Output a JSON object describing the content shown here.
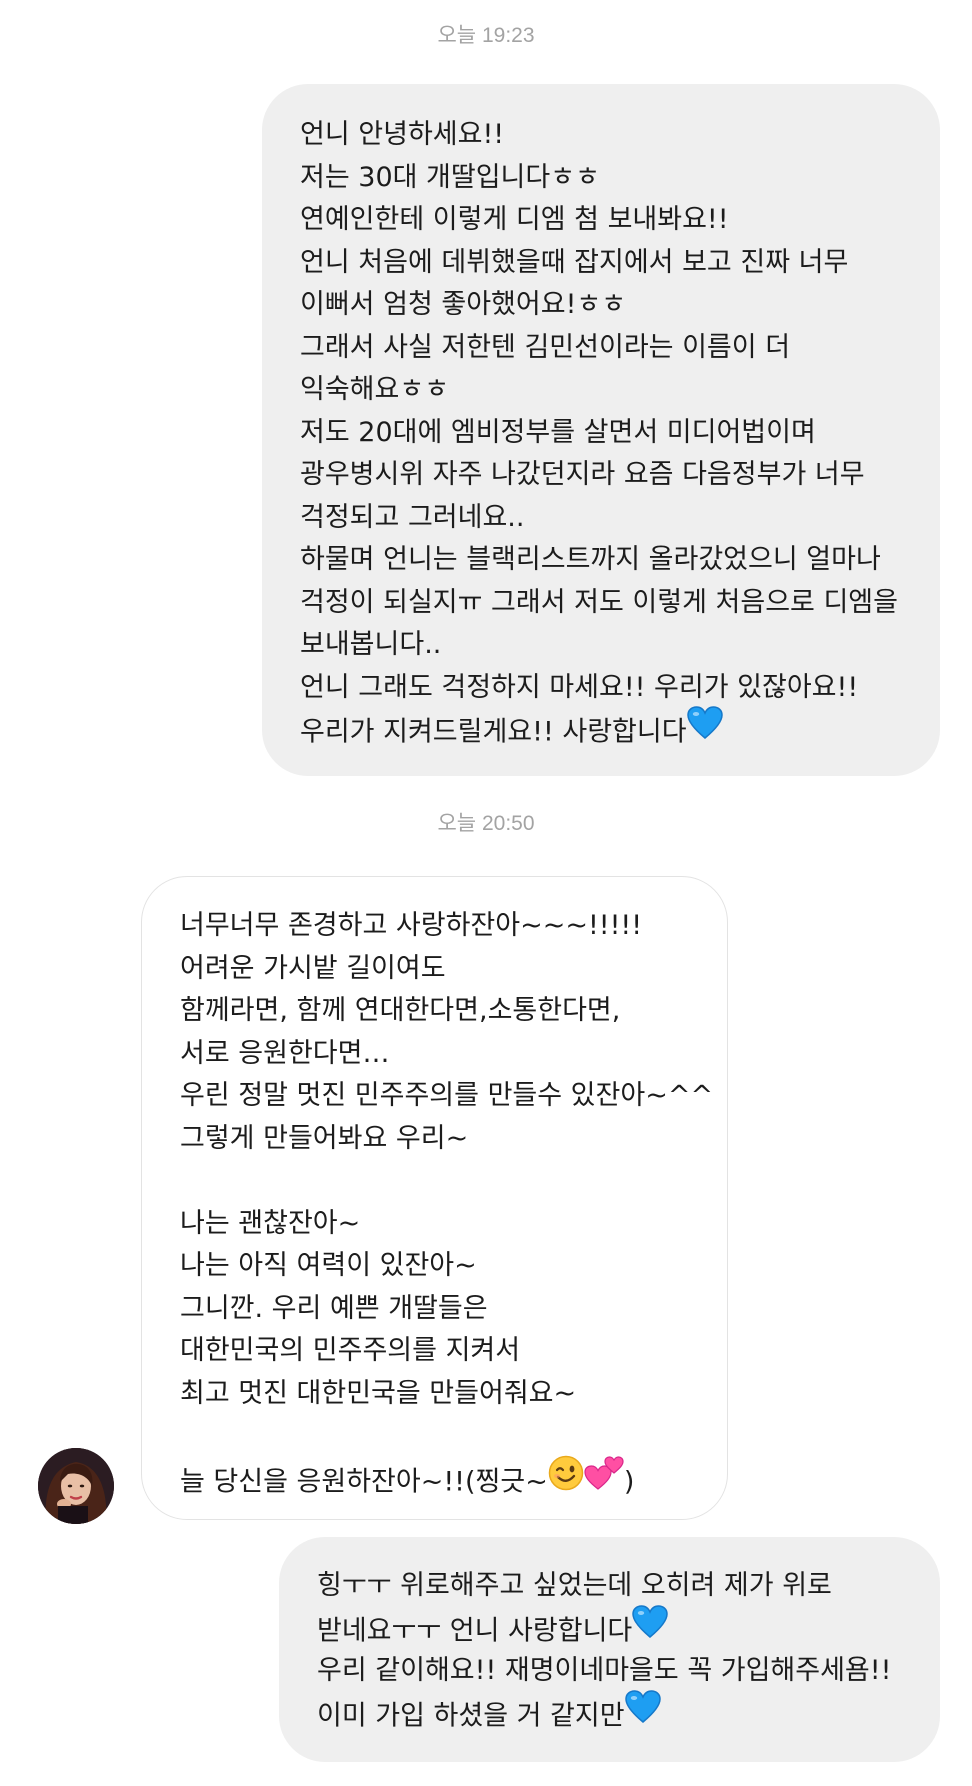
{
  "timestamps": {
    "first": "오늘 19:23",
    "second": "오늘 20:50"
  },
  "messages": {
    "m1": {
      "lines": [
        "언니 안녕하세요!!",
        "저는 30대 개딸입니다ㅎㅎ",
        "연예인한테 이렇게 디엠 첨 보내봐요!!",
        "언니 처음에 데뷔했을때 잡지에서 보고 진짜 너무",
        "이뻐서 엄청 좋아했어요!ㅎㅎ",
        "그래서 사실 저한텐 김민선이라는 이름이 더",
        "익숙해요ㅎㅎ",
        "저도 20대에 엠비정부를 살면서 미디어법이며",
        "광우병시위 자주 나갔던지라 요즘 다음정부가 너무",
        "걱정되고 그러네요..",
        "하물며 언니는 블랙리스트까지 올라갔었으니 얼마나",
        "걱정이 되실지ㅠ 그래서 저도 이렇게 처음으로 디엠을",
        "보내봅니다..",
        "언니 그래도 걱정하지 마세요!! 우리가 있잖아요!!",
        "우리가 지켜드릴게요!! 사랑합니다"
      ]
    },
    "m2": {
      "lines": [
        "너무너무 존경하고 사랑하잔아~~~!!!!!",
        "어려운 가시밭 길이여도",
        "함께라면, 함께 연대한다면,소통한다면,",
        "서로 응원한다면…",
        "우린 정말 멋진 민주주의를 만들수 있잔아~^^",
        "그렇게 만들어봐요 우리~",
        "",
        "나는 괜찮잔아~",
        "나는 아직 여력이 있잔아~",
        "그니깐. 우리 예쁜 개딸들은",
        "대한민국의 민주주의를 지켜서",
        "최고 멋진 대한민국을 만들어줘요~",
        "",
        "늘 당신을 응원하잔아~!!(찡긋~"
      ],
      "closing_paren": ")"
    },
    "m3": {
      "lines": [
        "힝ㅜㅜ 위로해주고 싶었는데 오히려 제가 위로",
        "받네요ㅜㅜ 언니 사랑합니다",
        "우리 같이해요!! 재명이네마을도 꼭 가입해주세욤!!",
        "이미 가입 하셨을 거 같지만"
      ]
    }
  },
  "emoji": {
    "blue_heart": "blue-heart-icon",
    "wink": "winking-face-icon",
    "two_hearts": "two-hearts-icon"
  },
  "colors": {
    "outgoing_bubble": "#efefef",
    "incoming_border": "#e3e3e3",
    "timestamp_text": "#a3a3a3",
    "blue_heart": "#1e9ef2"
  }
}
